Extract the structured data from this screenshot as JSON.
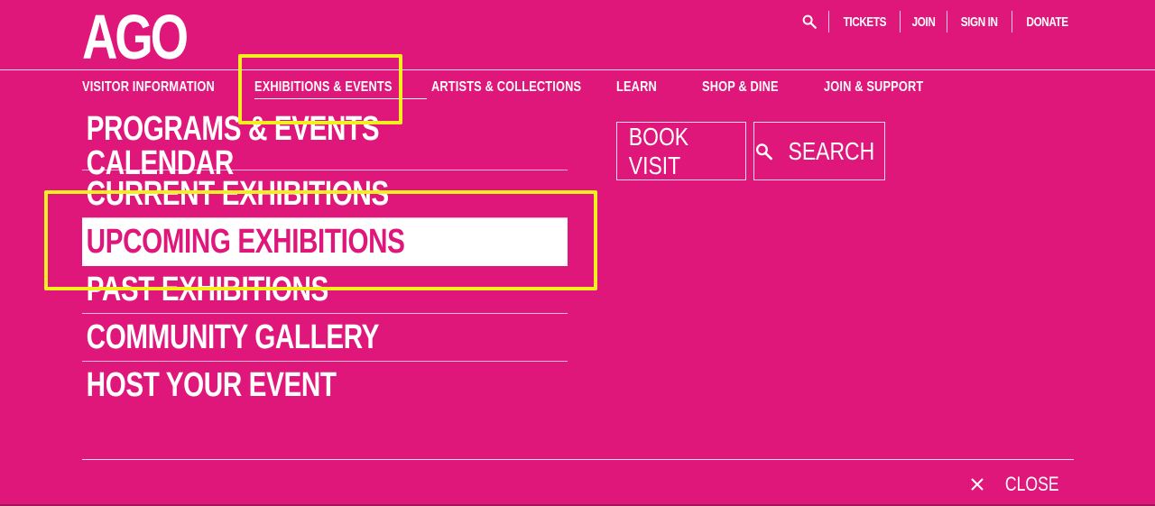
{
  "colors": {
    "background": "#e0177a",
    "highlight": "#f4ef1e",
    "text": "#ffffff"
  },
  "logo": "AGO",
  "utility": {
    "search_icon": "search-icon",
    "items": [
      "TICKETS",
      "JOIN",
      "SIGN IN",
      "DONATE"
    ]
  },
  "nav": {
    "items": [
      {
        "label": "VISITOR INFORMATION"
      },
      {
        "label": "EXHIBITIONS & EVENTS",
        "active": true
      },
      {
        "label": "ARTISTS & COLLECTIONS"
      },
      {
        "label": "LEARN"
      },
      {
        "label": "SHOP & DINE"
      },
      {
        "label": "JOIN & SUPPORT"
      }
    ]
  },
  "menu": {
    "items": [
      {
        "label": "PROGRAMS & EVENTS CALENDAR"
      },
      {
        "label": "CURRENT EXHIBITIONS"
      },
      {
        "label": "UPCOMING EXHIBITIONS",
        "selected": true
      },
      {
        "label": "PAST EXHIBITIONS"
      },
      {
        "label": "COMMUNITY GALLERY"
      },
      {
        "label": "HOST YOUR EVENT"
      }
    ]
  },
  "actions": {
    "book_visit": "BOOK VISIT",
    "search": "SEARCH"
  },
  "close": {
    "label": "CLOSE"
  }
}
